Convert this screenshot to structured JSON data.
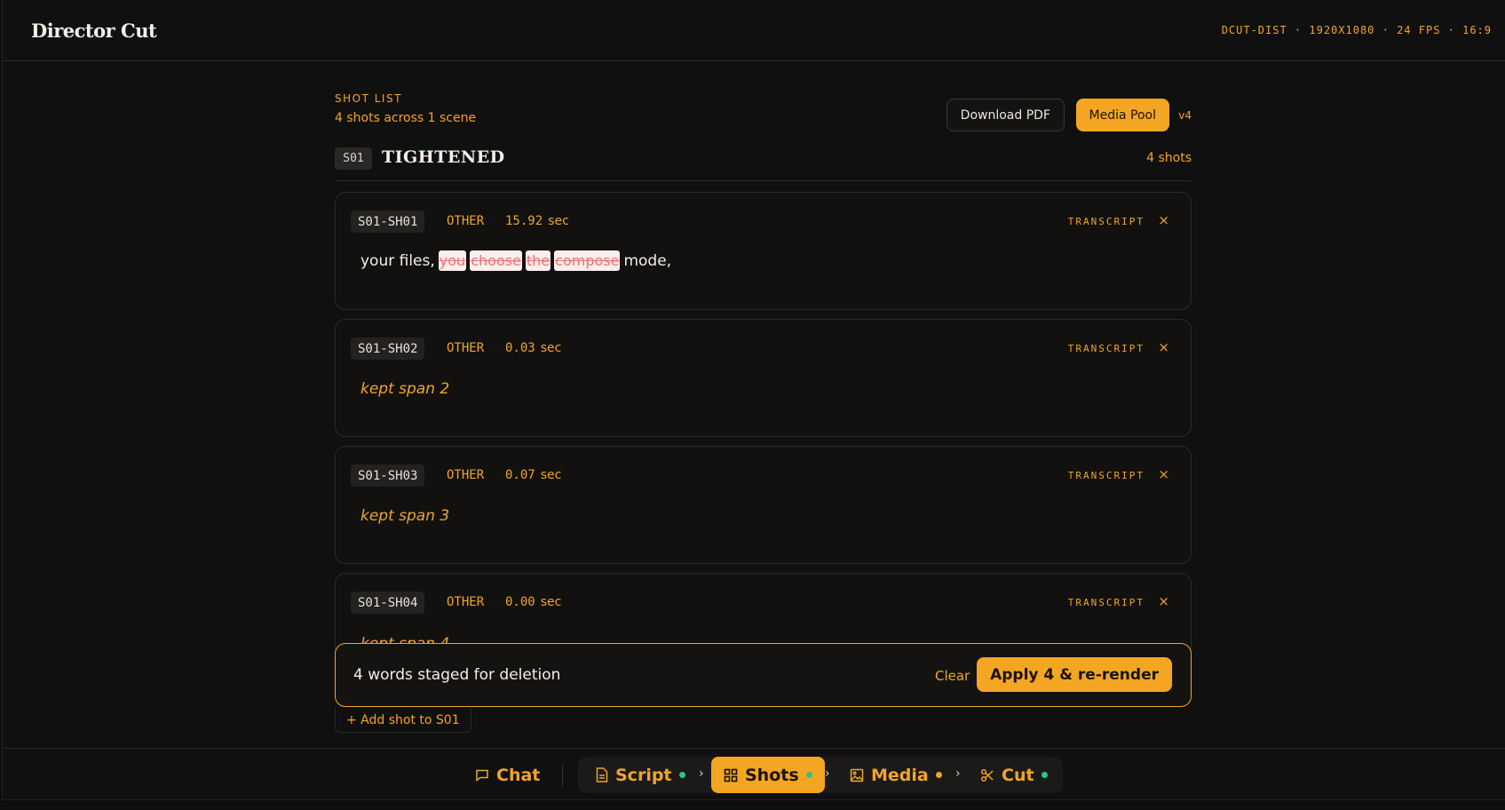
{
  "app": {
    "title": "Director Cut",
    "meta": "DCUT-DIST · 1920X1080 · 24 FPS · 16:9"
  },
  "shot_list": {
    "label": "SHOT LIST",
    "summary": "4 shots across 1 scene",
    "download_label": "Download PDF",
    "media_pool_label": "Media Pool",
    "version": "v4"
  },
  "scene": {
    "code": "S01",
    "title": "TIGHTENED",
    "count": "4 shots"
  },
  "shots": [
    {
      "id": "S01-SH01",
      "type": "OTHER",
      "duration": "15.92",
      "unit": "sec",
      "transcript_label": "TRANSCRIPT",
      "close": "×",
      "words_before": "your files,",
      "deleted_words": [
        "you",
        "choose",
        "the",
        "compose"
      ],
      "words_after": "mode,"
    },
    {
      "id": "S01-SH02",
      "type": "OTHER",
      "duration": "0.03",
      "unit": "sec",
      "transcript_label": "TRANSCRIPT",
      "close": "×",
      "kept": "kept span 2"
    },
    {
      "id": "S01-SH03",
      "type": "OTHER",
      "duration": "0.07",
      "unit": "sec",
      "transcript_label": "TRANSCRIPT",
      "close": "×",
      "kept": "kept span 3"
    },
    {
      "id": "S01-SH04",
      "type": "OTHER",
      "duration": "0.00",
      "unit": "sec",
      "transcript_label": "TRANSCRIPT",
      "close": "×",
      "kept": "kept span 4"
    }
  ],
  "staged": {
    "message": "4 words staged for deletion",
    "clear_label": "Clear",
    "apply_label": "Apply 4 & re-render"
  },
  "add_shot_label": "+ Add shot to S01",
  "nav": {
    "chat": "Chat",
    "script": "Script",
    "shots": "Shots",
    "media": "Media",
    "cut": "Cut",
    "chevron": "›"
  },
  "colors": {
    "accent": "#f4a623",
    "status_done": "#2bc784",
    "status_pending": "#f0a42a",
    "deleted_text": "#e9756f"
  }
}
